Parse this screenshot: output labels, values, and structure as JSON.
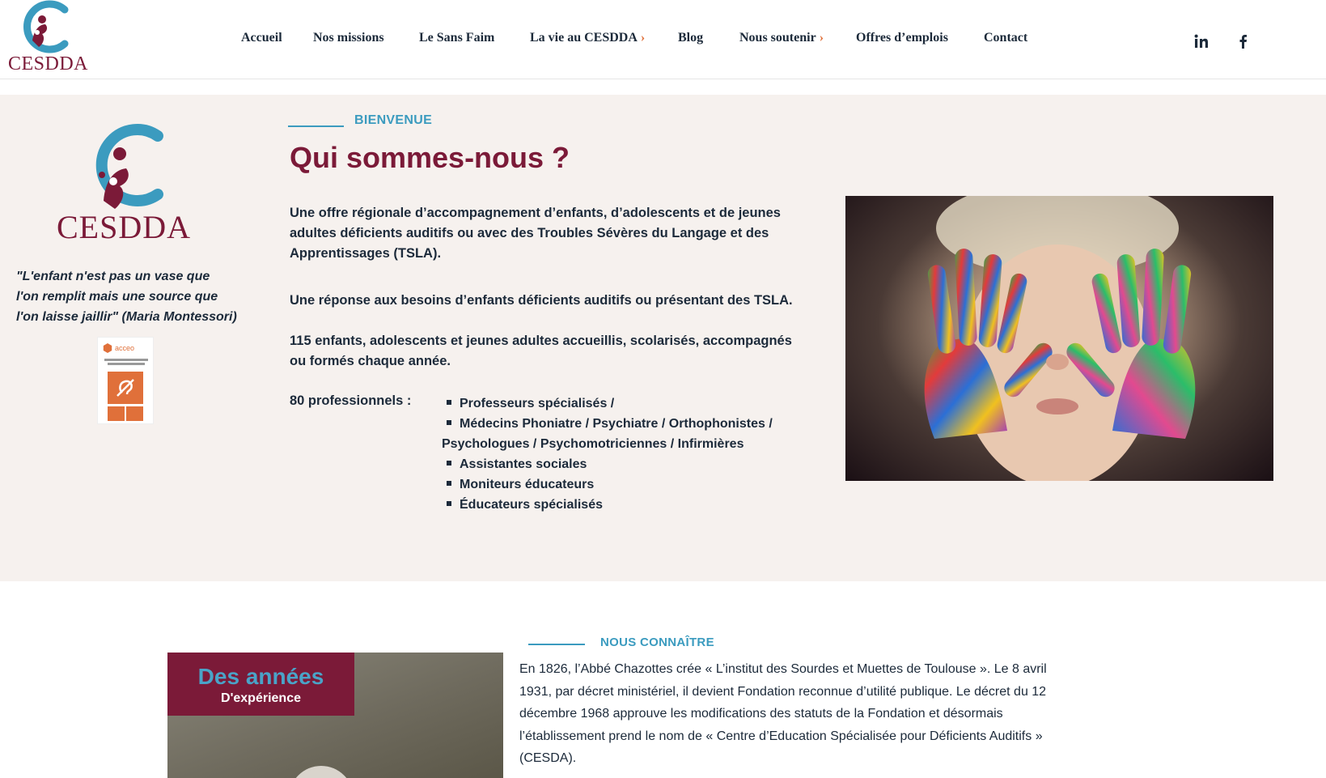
{
  "brand": {
    "name": "CESDDA"
  },
  "nav": {
    "items": [
      {
        "label": "Accueil",
        "dropdown": false
      },
      {
        "label": "Nos missions",
        "dropdown": false
      },
      {
        "label": "Le Sans Faim",
        "dropdown": false
      },
      {
        "label": "La vie au CESDDA",
        "dropdown": true
      },
      {
        "label": "Blog",
        "dropdown": false
      },
      {
        "label": "Nous soutenir",
        "dropdown": true
      },
      {
        "label": "Offres d’emplois",
        "dropdown": false
      },
      {
        "label": "Contact",
        "dropdown": false
      }
    ],
    "caret": "›",
    "social": [
      {
        "icon": "linkedin-icon"
      },
      {
        "icon": "facebook-icon"
      }
    ]
  },
  "sidebar": {
    "quote_lines": [
      "\"L'enfant n'est pas un vase que",
      "l'on remplit mais une source que",
      "l'on laisse jaillir\" (Maria Montessori)"
    ],
    "badge": {
      "brand": "acceo"
    }
  },
  "hero": {
    "kicker": "BIENVENUE",
    "title": "Qui sommes-nous ?",
    "paragraphs": [
      "Une offre régionale d’accompagnement d’enfants, d’adolescents et de jeunes adultes déficients auditifs ou avec des Troubles Sévères du Langage et des Apprentissages (TSLA).",
      "Une réponse aux besoins d’enfants déficients auditifs ou présentant des TSLA.",
      "115 enfants, adolescents et jeunes adultes accueillis, scolarisés, accompagnés ou formés chaque année."
    ],
    "pros_label": "80 professionnels :",
    "pros": [
      "Professeurs spécialisés /",
      "Médecins Phoniatre / Psychiatre / Orthophonistes / Psychologues / Psychomotriciennes / Infirmières",
      "Assistantes sociales",
      "Moniteurs éducateurs",
      "Éducateurs spécialisés"
    ]
  },
  "about": {
    "kicker": "NOUS CONNAÎTRE",
    "exp_big": "Des années",
    "exp_small": "D'expérience",
    "text": "En 1826, l’Abbé Chazottes crée « L’institut des Sourdes et Muettes de Toulouse ». Le 8 avril 1931, par décret ministériel, il devient Fondation reconnue d’utilité publique. Le décret du 12 décembre 1968 approuve les modifications des statuts de la Fondation et désormais l’établissement prend le nom de « Centre d’Education Spécialisée pour Déficients Auditifs » (CESDA)."
  },
  "colors": {
    "brand_burgundy": "#7b1a38",
    "brand_blue": "#3b9bbf",
    "accent_orange": "#e0703a",
    "hero_bg": "#f6f1ee",
    "text_dark": "#1c2a3a"
  }
}
